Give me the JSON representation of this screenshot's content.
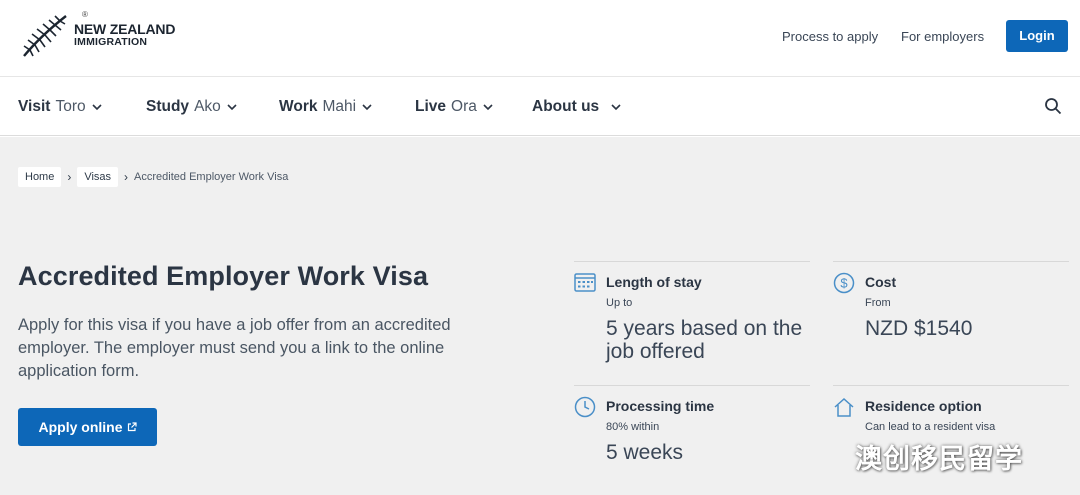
{
  "header": {
    "logo_line1": "NEW ZEALAND",
    "logo_line2": "IMMIGRATION",
    "logo_mark": "®",
    "util_links": [
      "Process to apply",
      "For employers"
    ],
    "login_label": "Login"
  },
  "nav": {
    "items": [
      {
        "en": "Visit",
        "mi": "Toro"
      },
      {
        "en": "Study",
        "mi": "Ako"
      },
      {
        "en": "Work",
        "mi": "Mahi"
      },
      {
        "en": "Live",
        "mi": "Ora"
      },
      {
        "en": "About us",
        "mi": ""
      }
    ],
    "search_icon": "search-icon"
  },
  "breadcrumb": [
    "Home",
    "Visas",
    "Accredited Employer Work Visa"
  ],
  "page": {
    "title": "Accredited Employer Work Visa",
    "intro": "Apply for this visa if you have a job offer from an accredited employer. The employer must send you a link to the online application form.",
    "apply_label": "Apply online"
  },
  "facts": [
    {
      "icon": "calendar-icon",
      "title": "Length of stay",
      "sub": "Up to",
      "value": "5 years based on the job offered"
    },
    {
      "icon": "dollar-icon",
      "title": "Cost",
      "sub": "From",
      "value": "NZD $1540"
    },
    {
      "icon": "clock-icon",
      "title": "Processing time",
      "sub": "80% within",
      "value": "5 weeks"
    },
    {
      "icon": "house-icon",
      "title": "Residence option",
      "sub": "Can lead to a resident visa",
      "value": ""
    }
  ],
  "watermark": "澳创移民留学",
  "colors": {
    "accent": "#0d67b8",
    "page_bg": "#f0f0f0",
    "text": "#2b3543"
  }
}
